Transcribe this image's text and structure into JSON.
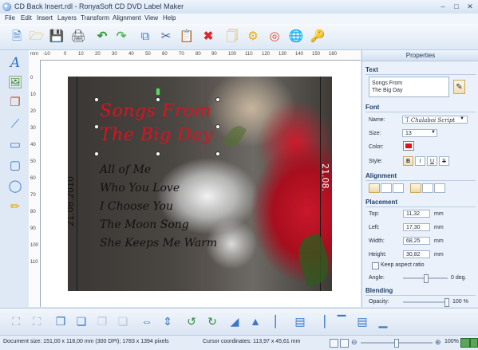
{
  "window": {
    "title": "CD Back Insert.rdl - RonyaSoft CD DVD Label Maker"
  },
  "menu": [
    "File",
    "Edit",
    "Insert",
    "Layers",
    "Transform",
    "Alignment",
    "View",
    "Help"
  ],
  "toolbar_icons": [
    "new-icon",
    "open-icon",
    "save-icon",
    "print-icon",
    "undo-icon",
    "redo-icon",
    "copy-icon",
    "cut-icon",
    "paste-icon",
    "delete-icon",
    "properties-icon",
    "settings-icon",
    "help-icon",
    "web-icon",
    "key-icon"
  ],
  "ruler": {
    "unit": "mm",
    "top_ticks": [
      "-10",
      "0",
      "10",
      "20",
      "30",
      "40",
      "50",
      "60",
      "70",
      "80",
      "90",
      "100",
      "110",
      "120",
      "130",
      "140",
      "150",
      "160"
    ],
    "left_ticks": [
      "0",
      "10",
      "20",
      "30",
      "40",
      "50",
      "60",
      "70",
      "80",
      "90",
      "100",
      "110"
    ]
  },
  "design": {
    "spine_left": "21.08.2010",
    "spine_right": "21.08.",
    "headline": [
      "Songs From",
      "The Big Day"
    ],
    "songs": [
      "All of Me",
      "Who You Love",
      "I Choose You",
      "The Moon Song",
      "She Keeps Me Warm"
    ]
  },
  "properties": {
    "header": "Properties",
    "text_section": "Text",
    "text_value": "Songs From\nThe Big Day",
    "font_section": "Font",
    "name_label": "Name:",
    "name_value": "Chalaboi Script",
    "size_label": "Size:",
    "size_value": "13",
    "color_label": "Color:",
    "color_value": "#e0101e",
    "style_label": "Style:",
    "style_buttons": [
      "B",
      "I",
      "U",
      "S"
    ],
    "alignment_section": "Alignment",
    "placement_section": "Placement",
    "top_label": "Top:",
    "top_value": "11,32",
    "left_label": "Left:",
    "left_value": "17,30",
    "width_label": "Width:",
    "width_value": "68,25",
    "height_label": "Height:",
    "height_value": "30,82",
    "unit": "mm",
    "aspect_label": "Keep aspect ratio",
    "angle_label": "Angle:",
    "angle_value": "0 deg.",
    "blending_section": "Blending",
    "opacity_label": "Opacity:",
    "opacity_value": "100 %"
  },
  "status": {
    "doc_size": "Document size: 151,00 x 118,00 mm (300 DPI); 1783 x 1394 pixels",
    "cursor": "Cursor coordinates: 113,97 x 45,61 mm",
    "zoom": "100%"
  }
}
